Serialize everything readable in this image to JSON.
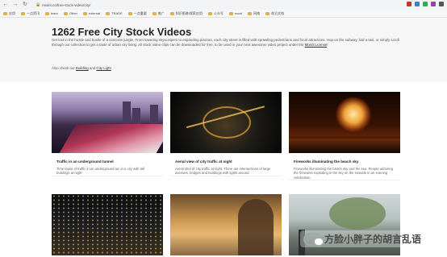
{
  "browser": {
    "url": "mixkit.co/free-stock-video/city/",
    "bookmarks": [
      "应用",
      "一点资讯",
      "learn",
      "Other",
      "external",
      "TRADE",
      "一点重要",
      "推广",
      "知识图谱/搜索应用",
      "公众号",
      "excel",
      "网络",
      "前沿文档"
    ]
  },
  "page": {
    "title": "1262 Free City Stock Videos",
    "intro": "Get lost in the hustle and bustle of a concrete jungle. From towering skyscrapers to expanding piazzas, each city street is filled with sprawling pedestrians and focal attractions. Hop on the subway, hail a taxi, or simply scroll through our collection to get a taste of urban city living. All stock video clips can be downloaded for free, to be used in your next awesome video project under the ",
    "license_link": "Mixkit License",
    "intro_end": "!",
    "also_prefix": "Also check our ",
    "also_link1": "Building",
    "also_and": " and ",
    "also_link2": "City Light"
  },
  "cards": [
    {
      "title": "Traffic in an underground tunnel",
      "desc": "Time lapse of traffic in an underground tun in a city with tall buildings at night"
    },
    {
      "title": "Aerial view of city traffic at night",
      "desc": "Aerial shot of city traffic at night. There are intersections of large avenues, bridges and buildings with lights around."
    },
    {
      "title": "Fireworks illuminating the beach sky",
      "desc": "Fireworks illuminating the beach sky and the sea. People admiring the fireworks exploding in the sky on the seaside in an evening celebration."
    }
  ],
  "watermark": {
    "text": "方脸小胖子的胡言乱语"
  },
  "colors": {
    "hero_bg": "#f6f6f6",
    "bookmark_folder": "#e0b341"
  }
}
